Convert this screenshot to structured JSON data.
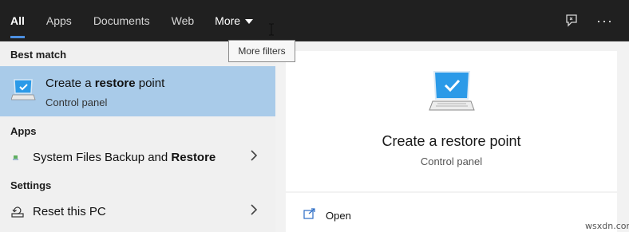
{
  "tabs": [
    {
      "label": "All",
      "active": true
    },
    {
      "label": "Apps"
    },
    {
      "label": "Documents"
    },
    {
      "label": "Web"
    },
    {
      "label": "More",
      "icon": "caret-down-icon"
    }
  ],
  "top_right": {
    "feedback_icon": "feedback-icon",
    "more_options_label": "···"
  },
  "tooltip": {
    "text": "More filters"
  },
  "left": {
    "best_match_header": "Best match",
    "best_match": {
      "title_prefix": "Create a ",
      "title_bold": "restore",
      "title_suffix": " point",
      "subtitle": "Control panel",
      "icon": "monitor-checkmark-icon"
    },
    "apps_header": "Apps",
    "apps": [
      {
        "label_prefix": "System Files Backup and ",
        "label_bold": "Restore",
        "icon": "app-icon"
      }
    ],
    "settings_header": "Settings",
    "settings": [
      {
        "label": "Reset this PC",
        "icon": "reset-icon"
      }
    ]
  },
  "right": {
    "title": "Create a restore point",
    "subtitle": "Control panel",
    "icon": "monitor-checkmark-icon",
    "actions": [
      {
        "label": "Open",
        "icon": "open-icon"
      }
    ]
  },
  "watermark": "wsxdn.com",
  "colors": {
    "topbar": "#202020",
    "accent": "#4c8fe0",
    "selected": "#a9cbe9",
    "left_pane": "#f0f0f0"
  }
}
